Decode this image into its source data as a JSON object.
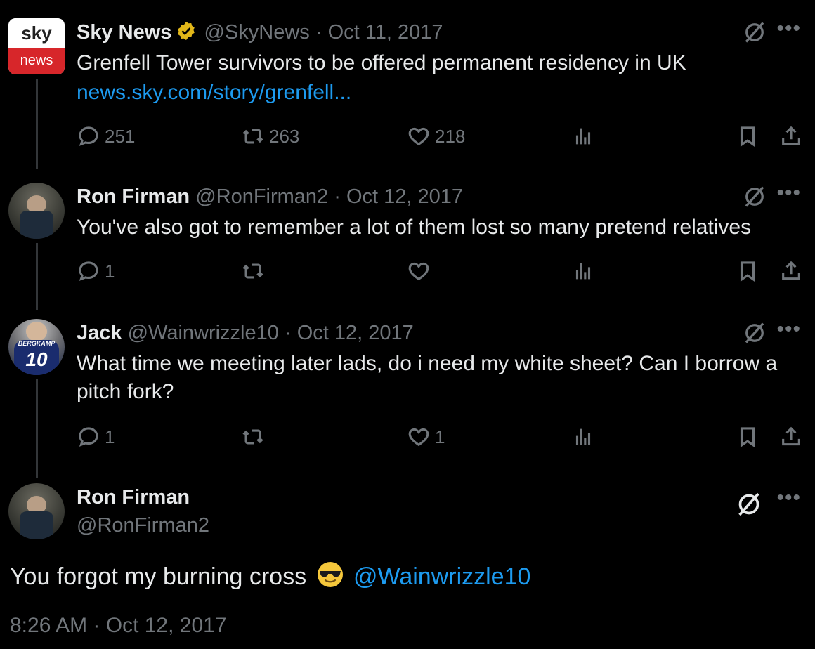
{
  "tweets": [
    {
      "name": "Sky News",
      "handle": "@SkyNews",
      "sep": "·",
      "date": "Oct 11, 2017",
      "text": "Grenfell Tower survivors to be offered permanent residency in UK",
      "link": "news.sky.com/story/grenfell...",
      "replies": "251",
      "retweets": "263",
      "likes": "218",
      "logo_top": "sky",
      "logo_bottom": "news"
    },
    {
      "name": "Ron Firman",
      "handle": "@RonFirman2",
      "sep": "·",
      "date": "Oct 12, 2017",
      "text": "You've also got to remember a lot of them lost so many pretend relatives",
      "replies": "1",
      "retweets": "",
      "likes": ""
    },
    {
      "name": "Jack",
      "handle": "@Wainwrizzle10",
      "sep": "·",
      "date": "Oct 12, 2017",
      "text_line1": "What time we meeting later lads, do i need my white sheet? Can I borrow a",
      "text_line2": "pitch fork?",
      "replies": "1",
      "retweets": "",
      "likes": "1",
      "jersey_name": "BERGKAMP",
      "jersey_number": "10"
    }
  ],
  "main": {
    "name": "Ron Firman",
    "handle": "@RonFirman2",
    "text": "You forgot my burning cross",
    "mention": "@Wainwrizzle10",
    "timestamp": "8:26 AM · Oct 12, 2017"
  },
  "icons": {
    "reply": "reply-icon",
    "retweet": "retweet-icon",
    "like": "like-icon",
    "views": "views-icon",
    "bookmark": "bookmark-icon",
    "share": "share-icon",
    "grok": "grok-icon",
    "more": "more-icon",
    "verified": "verified-badge-icon",
    "emoji": "sunglasses-emoji-icon"
  },
  "colors": {
    "background": "#000000",
    "text": "#e7e9ea",
    "muted": "#71767b",
    "link": "#1d9bf0",
    "verified_gold": "#e2b719",
    "sky_red": "#d7262a"
  }
}
